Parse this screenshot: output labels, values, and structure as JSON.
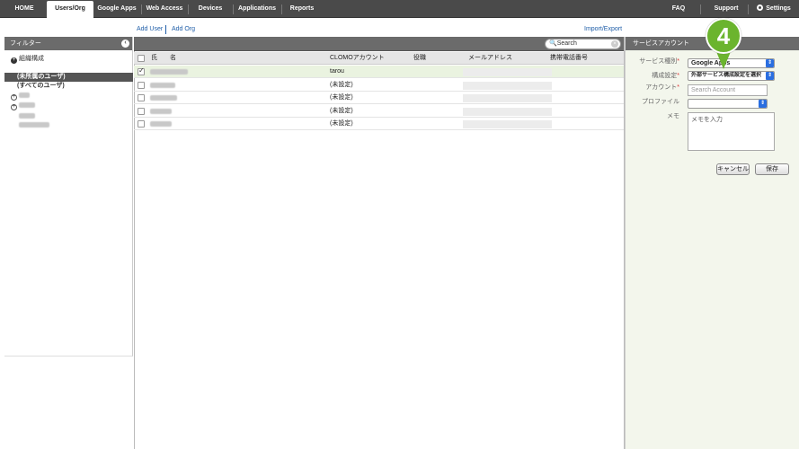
{
  "nav": {
    "tabs": [
      {
        "label": "HOME"
      },
      {
        "label": "Users/Org"
      },
      {
        "label": "Google Apps"
      },
      {
        "label": "Web Access"
      },
      {
        "label": "Devices"
      },
      {
        "label": "Applications"
      },
      {
        "label": "Reports"
      }
    ],
    "active_tab": "Users/Org",
    "right": {
      "faq": "FAQ",
      "support": "Support",
      "settings": "Settings"
    }
  },
  "actions": {
    "add_user": "Add User",
    "add_org": "Add Org",
    "import_export": "Import/Export"
  },
  "filter": {
    "title": "フィルター",
    "collapse_icon": "chevron-left-icon",
    "org_root": "組織構成",
    "unassigned": "(未所属のユーザ)",
    "all_users": "(すべてのユーザ)"
  },
  "search": {
    "placeholder": "Search"
  },
  "table": {
    "headers": {
      "last": "氏",
      "first": "名",
      "clomo": "CLOMOアカウント",
      "title": "役職",
      "email": "メールアドレス",
      "mobile": "携帯電話番号"
    },
    "rows": [
      {
        "clomo": "tarou",
        "checked": true
      },
      {
        "clomo": "(未設定)",
        "checked": false
      },
      {
        "clomo": "(未設定)",
        "checked": false
      },
      {
        "clomo": "(未設定)",
        "checked": false
      },
      {
        "clomo": "(未設定)",
        "checked": false
      }
    ]
  },
  "service_panel": {
    "title": "サービスアカウント",
    "service_type_label": "サービス種別",
    "service_type_value": "Google Apps",
    "config_label": "構成設定",
    "config_value": "外部サービス構成設定を選択",
    "account_label": "アカウント",
    "account_placeholder": "Search Account",
    "profile_label": "プロファイル",
    "memo_label": "メモ",
    "memo_placeholder": "メモを入力",
    "cancel": "キャンセル",
    "save": "保存"
  },
  "marker": {
    "number": "4",
    "color": "#6bb42e"
  },
  "colors": {
    "nav_bg": "#4a4a4a",
    "header_bar": "#6b6b6b",
    "link": "#1f5ea8",
    "required": "#dd3333",
    "select_arrow": "#2a6ee0",
    "selected_row": "#eaf3e0"
  }
}
